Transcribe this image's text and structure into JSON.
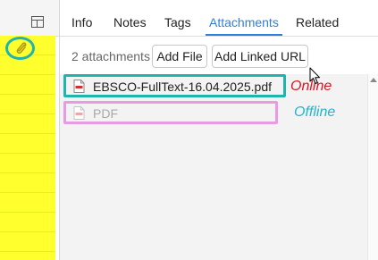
{
  "tabs": [
    {
      "label": "Info"
    },
    {
      "label": "Notes"
    },
    {
      "label": "Tags"
    },
    {
      "label": "Attachments",
      "active": true
    },
    {
      "label": "Related"
    }
  ],
  "toolbar": {
    "count_label": "2 attachments",
    "add_file_label": "Add File",
    "add_linked_url_label": "Add Linked URL"
  },
  "attachments": [
    {
      "name": "EBSCO-FullText-16.04.2025.pdf",
      "icon": "pdf-file-icon",
      "annotation": "Online"
    },
    {
      "name": "PDF",
      "icon": "pdf-file-icon",
      "annotation": "Offline"
    }
  ],
  "colors": {
    "highlight_yellow": "#ffff2e",
    "accent_blue": "#2f7fd8",
    "online_box": "#1fb5ad",
    "offline_box": "#e79be3",
    "online_text": "#e0141e",
    "offline_text": "#1fb5d0"
  }
}
